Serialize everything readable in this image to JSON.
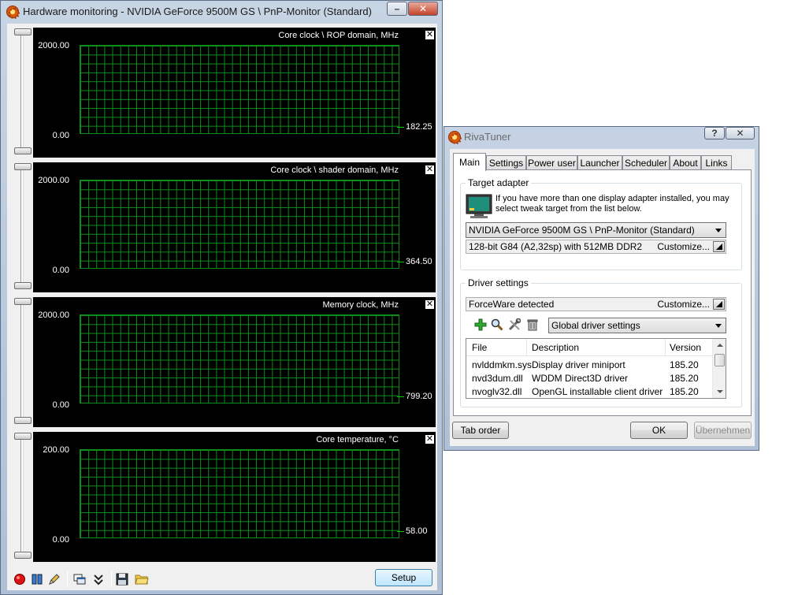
{
  "monitor_window": {
    "title": "Hardware monitoring - NVIDIA GeForce 9500M GS \\ PnP-Monitor (Standard)",
    "minimize_glyph": "–",
    "close_glyph": "✕",
    "panel_close_glyph": "✕",
    "graphs": [
      {
        "title": "Core clock \\ ROP domain, MHz",
        "max": "2000.00",
        "min": "0.00",
        "current": "182.25"
      },
      {
        "title": "Core clock \\ shader domain, MHz",
        "max": "2000.00",
        "min": "0.00",
        "current": "364.50"
      },
      {
        "title": "Memory clock, MHz",
        "max": "2000.00",
        "min": "0.00",
        "current": "799.20"
      },
      {
        "title": "Core temperature, °C",
        "max": "200.00",
        "min": "0.00",
        "current": "58.00"
      }
    ],
    "toolbar": {
      "icons": [
        "record-icon",
        "pause-icon",
        "pencil-icon",
        "windows-icon",
        "collapse-icon",
        "save-icon",
        "folder-icon"
      ],
      "setup_label": "Setup"
    }
  },
  "rivatuner": {
    "title": "RivaTuner",
    "help_glyph": "?",
    "close_glyph": "✕",
    "tabs": [
      "Main",
      "Settings",
      "Power user",
      "Launcher",
      "Scheduler",
      "About",
      "Links"
    ],
    "active_tab": "Main",
    "target_adapter": {
      "group_label": "Target adapter",
      "info_text": "If you have more than one display adapter installed, you may select tweak target from the list below.",
      "adapter_selected": "NVIDIA GeForce 9500M GS \\ PnP-Monitor (Standard)",
      "adapter_info": "128-bit G84 (A2,32sp) with 512MB DDR2",
      "customize_label": "Customize..."
    },
    "driver_settings": {
      "group_label": "Driver settings",
      "driver_status": "ForceWare detected",
      "customize_label": "Customize...",
      "profile_selected": "Global driver settings",
      "icons": [
        "add-icon",
        "search-icon",
        "tools-icon",
        "delete-icon"
      ],
      "columns": [
        "File",
        "Description",
        "Version"
      ],
      "rows": [
        {
          "file": "nvlddmkm.sys",
          "description": "Display driver miniport",
          "version": "185.20"
        },
        {
          "file": "nvd3dum.dll",
          "description": "WDDM Direct3D driver",
          "version": "185.20"
        },
        {
          "file": "nvoglv32.dll",
          "description": "OpenGL installable client driver",
          "version": "185.20"
        }
      ]
    },
    "buttons": {
      "tab_order": "Tab order",
      "ok": "OK",
      "apply": "Übernehmen"
    },
    "colors": {
      "graph_grid": "#0d8f1a",
      "graph_bg": "#000000",
      "accent": "#3c7fb1"
    }
  }
}
